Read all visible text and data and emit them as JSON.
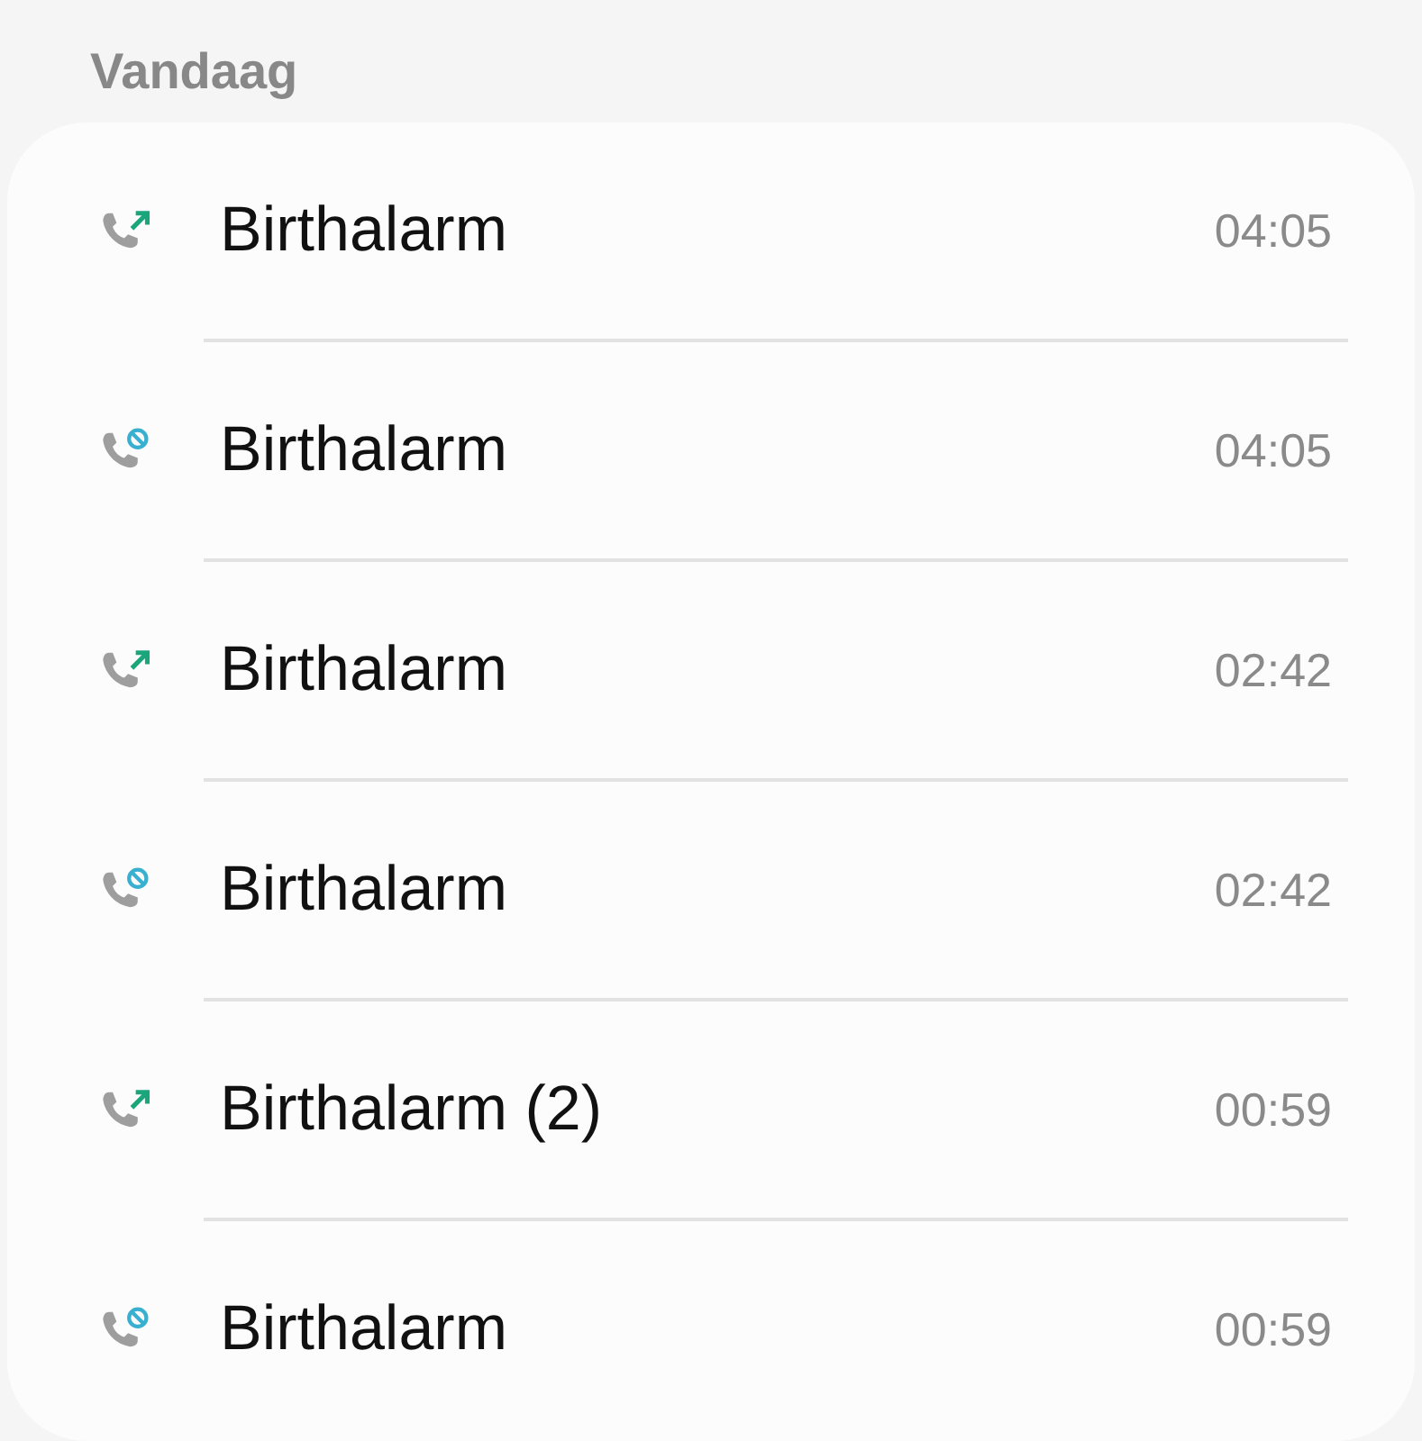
{
  "section": {
    "title": "Vandaag"
  },
  "calls": [
    {
      "kind": "outgoing",
      "name": "Birthalarm",
      "time": "04:05"
    },
    {
      "kind": "blocked",
      "name": "Birthalarm",
      "time": "04:05"
    },
    {
      "kind": "outgoing",
      "name": "Birthalarm",
      "time": "02:42"
    },
    {
      "kind": "blocked",
      "name": "Birthalarm",
      "time": "02:42"
    },
    {
      "kind": "outgoing",
      "name": "Birthalarm (2)",
      "time": "00:59"
    },
    {
      "kind": "blocked",
      "name": "Birthalarm",
      "time": "00:59"
    }
  ]
}
